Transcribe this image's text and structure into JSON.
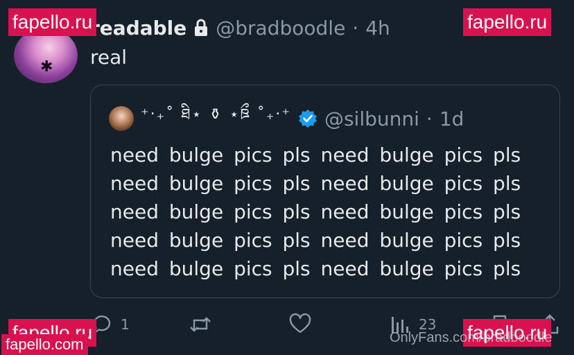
{
  "tweet": {
    "display_name": "readable",
    "handle": "@bradboodle",
    "separator": "·",
    "time": "4h",
    "text": "real",
    "lock_icon": "lock-icon"
  },
  "quote": {
    "display_name": "⁺‧₊˚ ཐི⋆ ⚱︎ ⋆ཋྀ ˚₊‧⁺",
    "handle": "@silbunni",
    "separator": "·",
    "time": "1d",
    "verified_color": "#1d9bf0",
    "lines": [
      "need bulge pics pls need bulge pics pls",
      "need bulge pics pls need bulge pics pls",
      "need bulge pics pls need bulge pics pls",
      "need bulge pics pls need bulge pics pls",
      "need bulge pics pls need bulge pics pls"
    ]
  },
  "actions": {
    "reply_count": "1",
    "retweet_count": "",
    "like_count": "",
    "views_count": "23"
  },
  "watermarks": {
    "top_left": "fapello.ru",
    "top_right": "fapello.ru",
    "bottom_left": "fapello.ru",
    "bottom_right": "fapello.ru",
    "bottom_site": "fapello.com",
    "onlyfans": "OnlyFans.com/bradboodle"
  },
  "colors": {
    "background": "#15202b",
    "text": "#e7e9ea",
    "muted": "#8b98a5",
    "border": "#38444d",
    "watermark": "#d9114e"
  }
}
